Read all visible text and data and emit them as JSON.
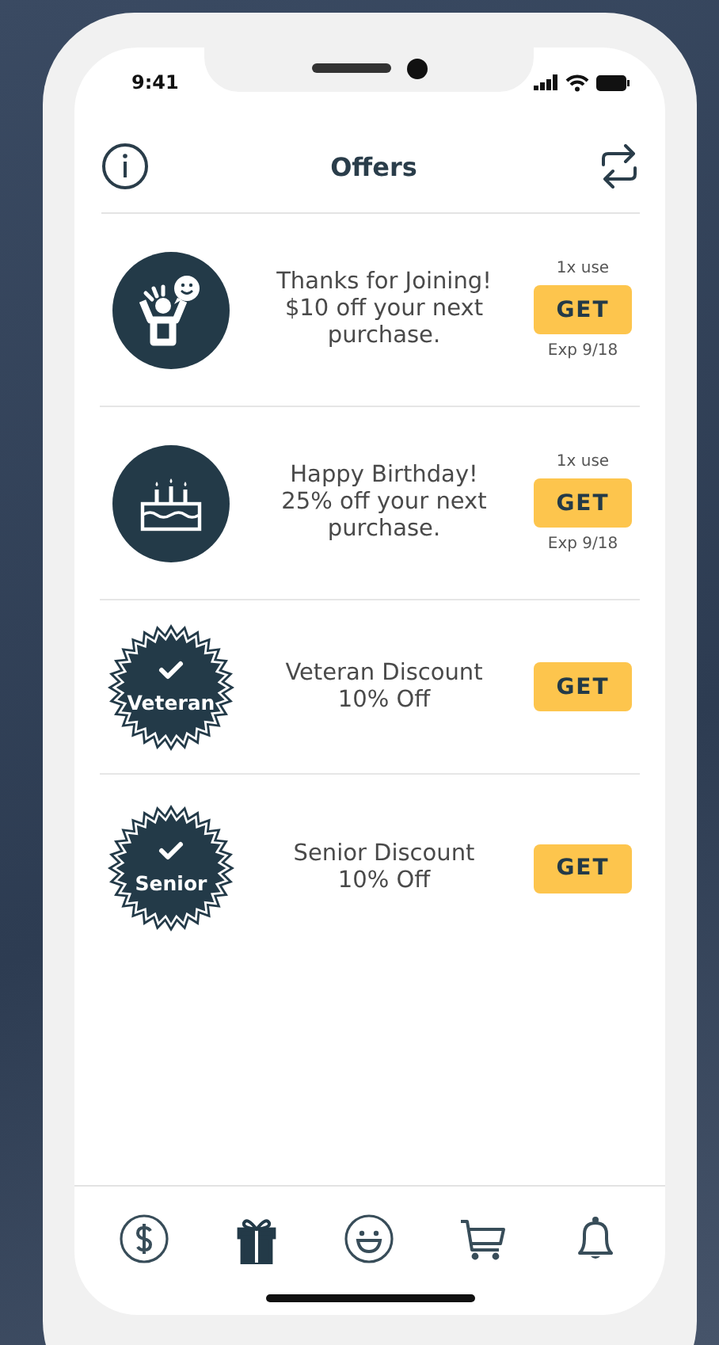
{
  "status_bar": {
    "time": "9:41"
  },
  "header": {
    "title": "Offers"
  },
  "offers": [
    {
      "kind": "person",
      "text": "Thanks for Joining!\n$10 off your next\npurchase.",
      "uses": "1x use",
      "button": "GET",
      "expiry": "Exp 9/18"
    },
    {
      "kind": "cake",
      "text": "Happy Birthday!\n25% off your next\npurchase.",
      "uses": "1x use",
      "button": "GET",
      "expiry": "Exp 9/18"
    },
    {
      "kind": "seal",
      "seal_label": "Veteran",
      "text": "Veteran Discount\n10% Off",
      "button": "GET"
    },
    {
      "kind": "seal",
      "seal_label": "Senior",
      "text": "Senior Discount\n10% Off",
      "button": "GET"
    }
  ],
  "tab_bar": [
    {
      "kind": "dollar",
      "selected": false
    },
    {
      "kind": "gift",
      "selected": true
    },
    {
      "kind": "smile",
      "selected": false
    },
    {
      "kind": "cart",
      "selected": false
    },
    {
      "kind": "bell",
      "selected": false
    }
  ]
}
